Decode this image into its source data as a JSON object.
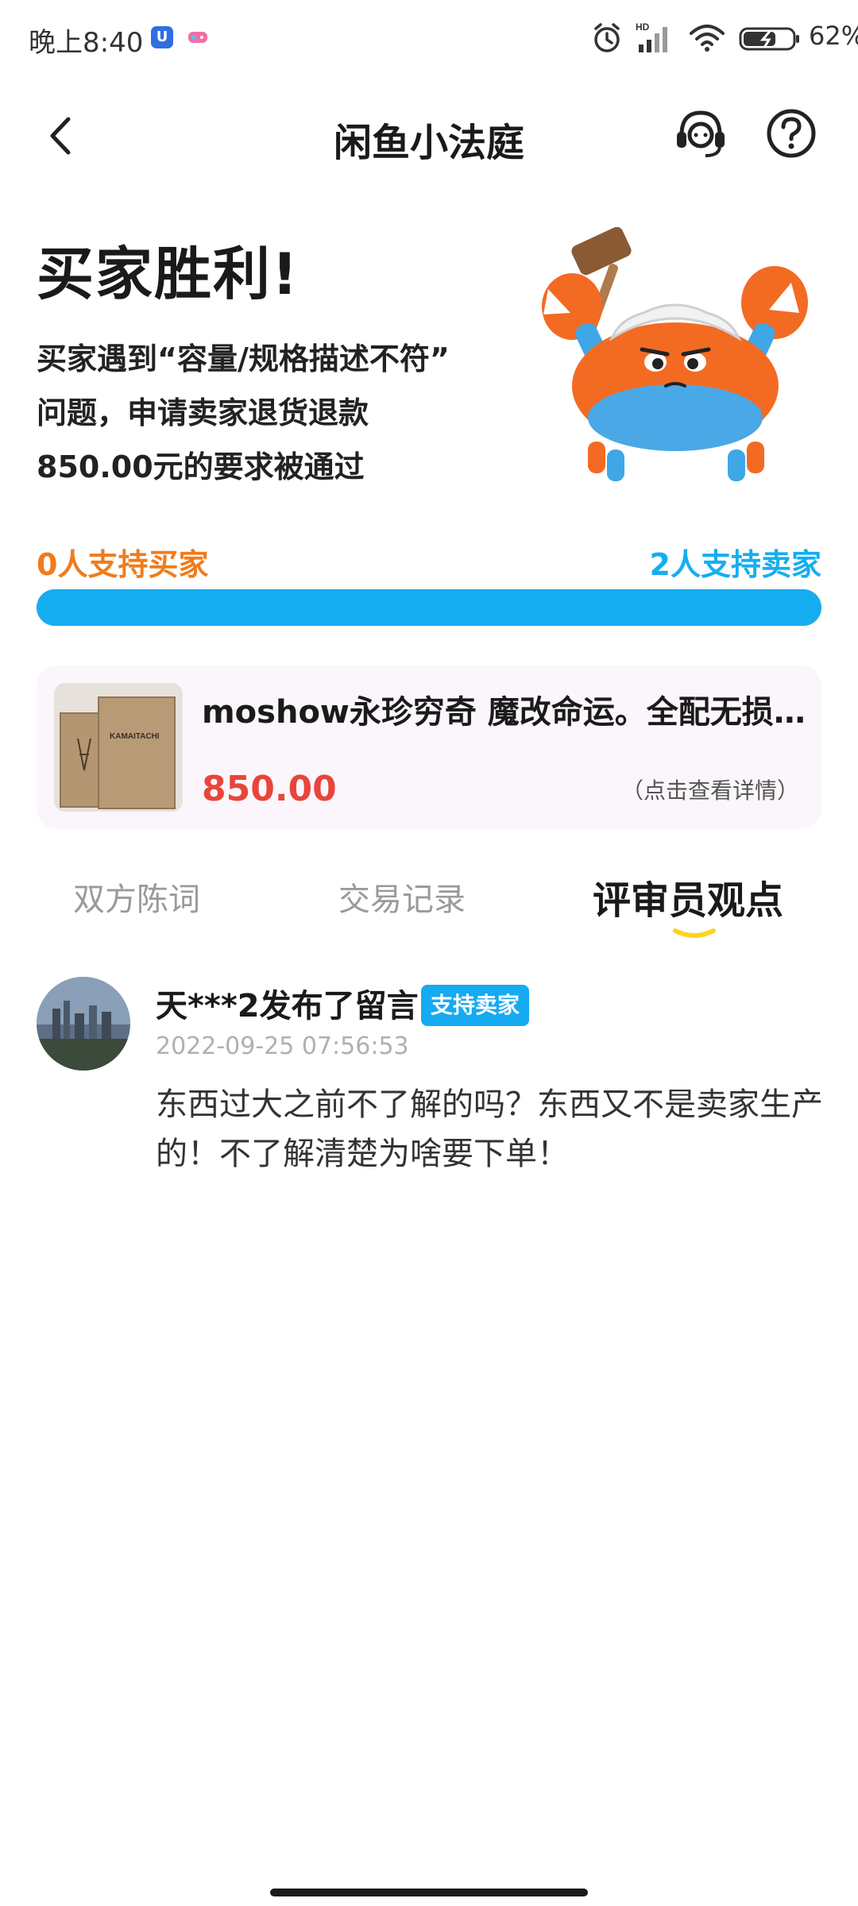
{
  "status_bar": {
    "time": "晚上8:40",
    "battery": "62%",
    "network_label": "HD"
  },
  "header": {
    "title": "闲鱼小法庭",
    "icons": [
      "back-arrow-icon",
      "customer-service-icon",
      "help-icon"
    ]
  },
  "verdict": {
    "title": "买家胜利!",
    "description": "买家遇到“容量/规格描述不符”问题，申请卖家退货退款850.00元的要求被通过",
    "description_lines": [
      "买家遇到“容量/规格描述不符”",
      "问题，申请卖家退货退款",
      "850.00元的要求被通过"
    ]
  },
  "votes": {
    "buyer_label": "0人支持买家",
    "seller_label": "2人支持卖家",
    "buyer_count": 0,
    "seller_count": 2,
    "seller_share": 1.0,
    "colors": {
      "buyer": "#f07c1c",
      "seller": "#14aef0"
    }
  },
  "product": {
    "title": "moshow永珍穷奇 魔改命运。全配无损带...",
    "price": "850.00",
    "detail_link": "（点击查看详情）",
    "thumb_text": "KAMAITACHI"
  },
  "tabs": [
    {
      "label": "双方陈词",
      "active": false
    },
    {
      "label": "交易记录",
      "active": false
    },
    {
      "label": "评审员观点",
      "active": true
    }
  ],
  "comment": {
    "author": "天***2发布了留言",
    "badge": "支持卖家",
    "time": "2022-09-25 07:56:53",
    "text": "东西过大之前不了解的吗？东西又不是卖家生产的！不了解清楚为啥要下单！"
  },
  "colors": {
    "accent_blue": "#14aef0",
    "accent_orange": "#f07c1c",
    "price_red": "#e8453c",
    "tab_indicator": "#ffd21f"
  }
}
